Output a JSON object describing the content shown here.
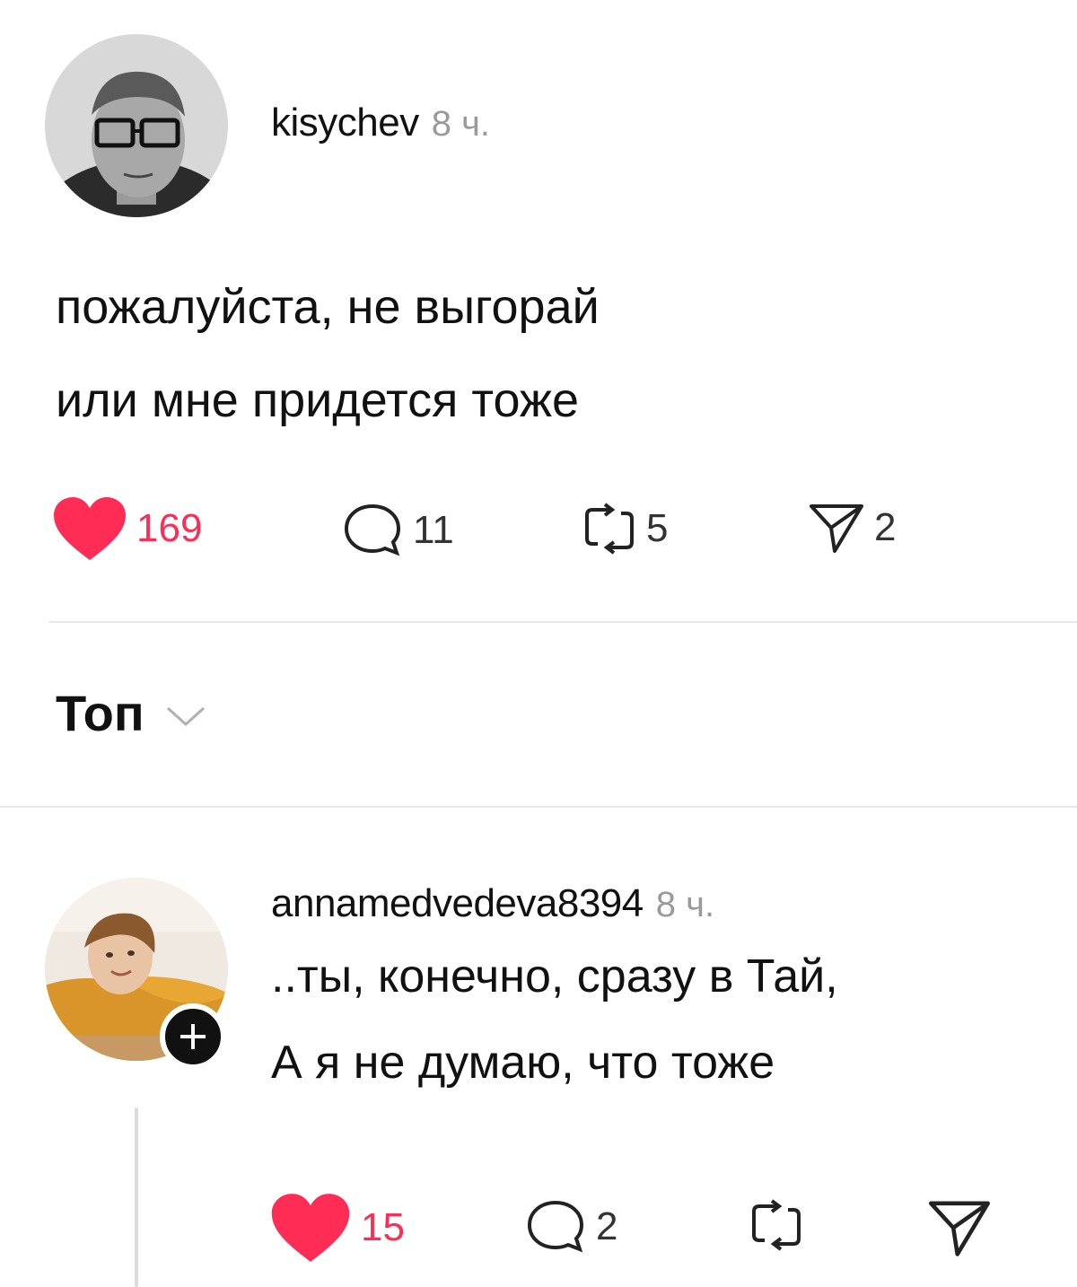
{
  "post": {
    "username": "kisychev",
    "time": "8 ч.",
    "lines": [
      "пожалуйста, не выгорай",
      "или мне придется тоже"
    ],
    "actions": {
      "likes": "169",
      "comments": "11",
      "reposts": "5",
      "shares": "2"
    }
  },
  "sort": {
    "label": "Топ"
  },
  "reply": {
    "username": "annamedvedeva8394",
    "time": "8 ч.",
    "lines": [
      "..ты, конечно, сразу в Тай,",
      "А я не думаю, что тоже"
    ],
    "actions": {
      "likes": "15",
      "comments": "2"
    }
  },
  "colors": {
    "like": "#ff2d55",
    "text": "#111111",
    "muted": "#9a9a9a",
    "divider": "#e6e6e6"
  },
  "icons": [
    "heart-icon",
    "comment-icon",
    "repost-icon",
    "share-icon",
    "chevron-down-icon",
    "plus-icon"
  ]
}
